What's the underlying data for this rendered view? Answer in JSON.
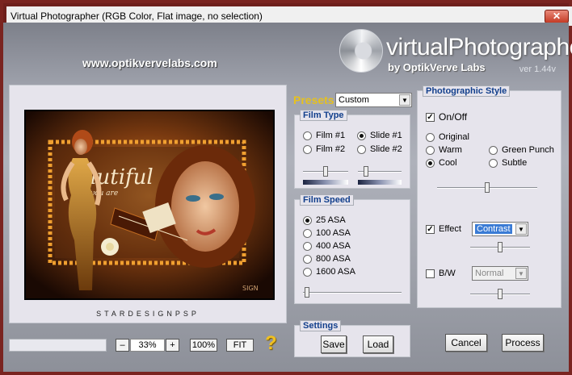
{
  "window": {
    "title": "Virtual Photographer (RGB Color, Flat image, no selection)",
    "close_label": "✕"
  },
  "header": {
    "website": "www.optikvervelabs.com",
    "logo_name": "virtualPhotographer",
    "logo_by": "by OptikVerve Labs",
    "version": "ver 1.44v"
  },
  "preview": {
    "caption": "STARDESIGNPSP"
  },
  "zoom": {
    "minus": "–",
    "value": "33%",
    "plus": "+",
    "hundred": "100%",
    "fit": "FIT",
    "help": "?"
  },
  "presets": {
    "label": "Presets",
    "selected": "Custom"
  },
  "film_type": {
    "title": "Film Type",
    "options": [
      {
        "label": "Film #1",
        "selected": false
      },
      {
        "label": "Slide #1",
        "selected": true
      },
      {
        "label": "Film #2",
        "selected": false
      },
      {
        "label": "Slide #2",
        "selected": false
      }
    ],
    "slider1_value": 0.5,
    "slider2_value": 0.15
  },
  "film_speed": {
    "title": "Film Speed",
    "options": [
      {
        "label": "25 ASA",
        "selected": true
      },
      {
        "label": "100 ASA",
        "selected": false
      },
      {
        "label": "400 ASA",
        "selected": false
      },
      {
        "label": "800 ASA",
        "selected": false
      },
      {
        "label": "1600 ASA",
        "selected": false
      }
    ],
    "slider_value": 0.02
  },
  "settings": {
    "title": "Settings",
    "save": "Save",
    "load": "Load"
  },
  "photo_style": {
    "title": "Photographic Style",
    "onoff": "On/Off",
    "onoff_checked": true,
    "options": [
      {
        "label": "Original",
        "selected": false
      },
      {
        "label": "Warm",
        "selected": false
      },
      {
        "label": "Green Punch",
        "selected": false
      },
      {
        "label": "Cool",
        "selected": true
      },
      {
        "label": "Subtle",
        "selected": false
      }
    ],
    "style_slider_value": 0.5,
    "effect": {
      "label": "Effect",
      "checked": true,
      "selected": "Contrast",
      "slider_value": 0.5
    },
    "bw": {
      "label": "B/W",
      "checked": false,
      "selected": "Normal",
      "slider_value": 0.5
    }
  },
  "actions": {
    "cancel": "Cancel",
    "process": "Process"
  },
  "colors": {
    "accent": "#123f8c",
    "presets_label": "#e6c11e",
    "frame": "#7a2420"
  }
}
